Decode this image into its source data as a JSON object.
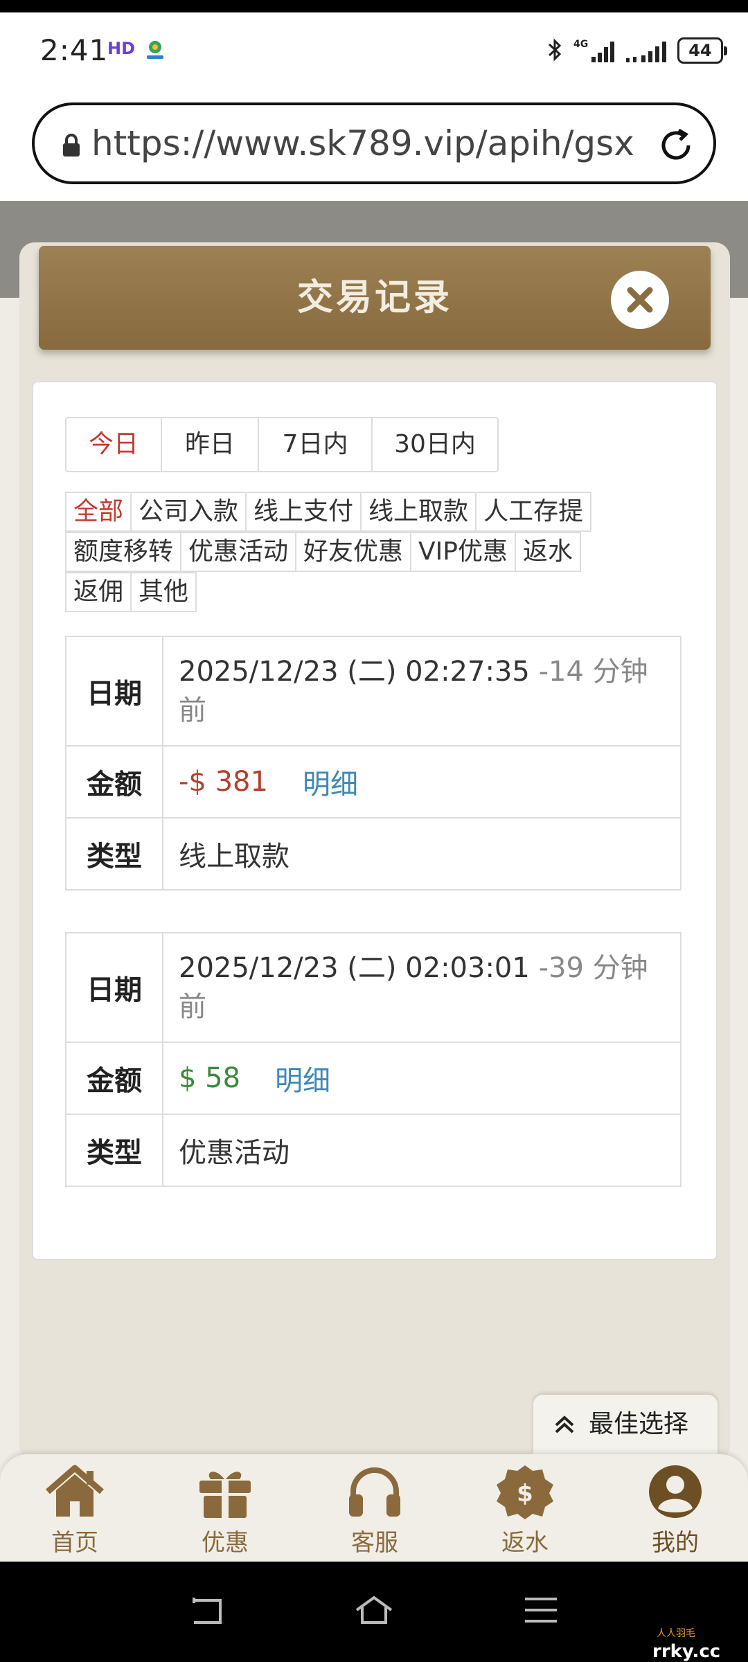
{
  "status_bar": {
    "time": "2:41",
    "hd": "HD",
    "battery": "44"
  },
  "browser": {
    "url": "https://www.sk789.vip/apih/gsx"
  },
  "modal": {
    "title": "交易记录"
  },
  "date_tabs": [
    {
      "label": "今日",
      "active": true
    },
    {
      "label": "昨日",
      "active": false
    },
    {
      "label": "7日内",
      "active": false
    },
    {
      "label": "30日内",
      "active": false
    }
  ],
  "categories": [
    {
      "label": "全部",
      "active": true
    },
    {
      "label": "公司入款",
      "active": false
    },
    {
      "label": "线上支付",
      "active": false
    },
    {
      "label": "线上取款",
      "active": false
    },
    {
      "label": "人工存提",
      "active": false
    },
    {
      "label": "额度移转",
      "active": false
    },
    {
      "label": "优惠活动",
      "active": false
    },
    {
      "label": "好友优惠",
      "active": false
    },
    {
      "label": "VIP优惠",
      "active": false
    },
    {
      "label": "返水",
      "active": false
    },
    {
      "label": "返佣",
      "active": false
    },
    {
      "label": "其他",
      "active": false
    }
  ],
  "record_labels": {
    "date": "日期",
    "amount": "金额",
    "type": "类型",
    "detail": "明细"
  },
  "records": [
    {
      "datetime": "2025/12/23 (二) 02:27:35",
      "relative": "-14 分钟前",
      "amount": "-$ 381",
      "amount_sign": "negative",
      "type": "线上取款"
    },
    {
      "datetime": "2025/12/23 (二) 02:03:01",
      "relative": "-39 分钟前",
      "amount": "$ 58",
      "amount_sign": "positive",
      "type": "优惠活动"
    }
  ],
  "best_choice": "最佳选择",
  "bottom_nav": [
    {
      "label": "首页",
      "icon": "home-icon"
    },
    {
      "label": "优惠",
      "icon": "gift-icon"
    },
    {
      "label": "客服",
      "icon": "headset-icon"
    },
    {
      "label": "返水",
      "icon": "dollar-badge-icon"
    },
    {
      "label": "我的",
      "icon": "user-icon"
    }
  ],
  "watermark": {
    "small": "人人羽毛",
    "main": "rrky.cc"
  },
  "colors": {
    "header_brown": "#8f7244",
    "active_red": "#c23b2f",
    "negative_amount": "#b5402f",
    "positive_amount": "#3a8a3a",
    "detail_blue": "#3f87b8",
    "nav_brown": "#8a6a3c"
  }
}
